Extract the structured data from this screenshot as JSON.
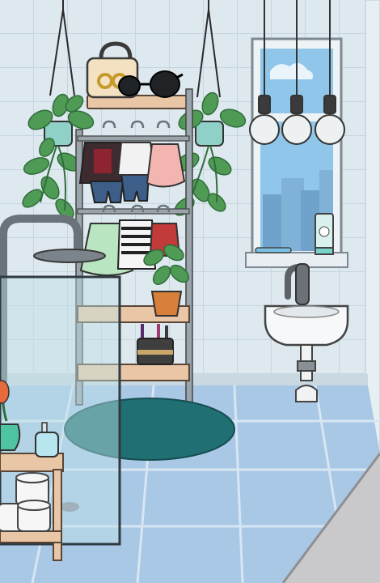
{
  "scene": {
    "title": "",
    "colors": {
      "wall": "#dde8ef",
      "wall_tile_line": "#c2d2dc",
      "floor": "#a9c8e6",
      "floor_line": "#d6e6f3",
      "shelf_wood": "#e9c6a6",
      "rack_metal": "#9aa4ab",
      "rug": "#1f6f73",
      "plant_leaf": "#4f9a55",
      "plant_leaf_dark": "#2f6e3a",
      "outline": "#3a3a3a",
      "glass": "#bfe3e6",
      "pot": "#d8803a"
    },
    "items": [
      {
        "name": "hanging-shelf",
        "icon": "shelf-icon"
      },
      {
        "name": "handbag",
        "icon": "handbag-icon"
      },
      {
        "name": "sunglasses",
        "icon": "sunglasses-icon"
      },
      {
        "name": "hanging-plant-left",
        "icon": "plant-icon"
      },
      {
        "name": "hanging-plant-right",
        "icon": "plant-icon"
      },
      {
        "name": "clothes-rack",
        "icon": "rack-icon"
      },
      {
        "name": "potted-plant",
        "icon": "plant-icon"
      },
      {
        "name": "makeup-cup",
        "icon": "cup-icon"
      },
      {
        "name": "round-rug",
        "icon": "rug-icon"
      },
      {
        "name": "window",
        "icon": "window-icon"
      },
      {
        "name": "pendant-lights",
        "icon": "bulb-icon"
      },
      {
        "name": "toothpaste",
        "icon": "tube-icon"
      },
      {
        "name": "toothbrush",
        "icon": "toothbrush-icon"
      },
      {
        "name": "sink",
        "icon": "sink-icon"
      },
      {
        "name": "shower",
        "icon": "shower-icon"
      },
      {
        "name": "soap-dispenser",
        "icon": "soap-icon"
      },
      {
        "name": "vase-flower",
        "icon": "flower-icon"
      },
      {
        "name": "toilet-paper",
        "icon": "toilet-paper-icon"
      }
    ]
  }
}
